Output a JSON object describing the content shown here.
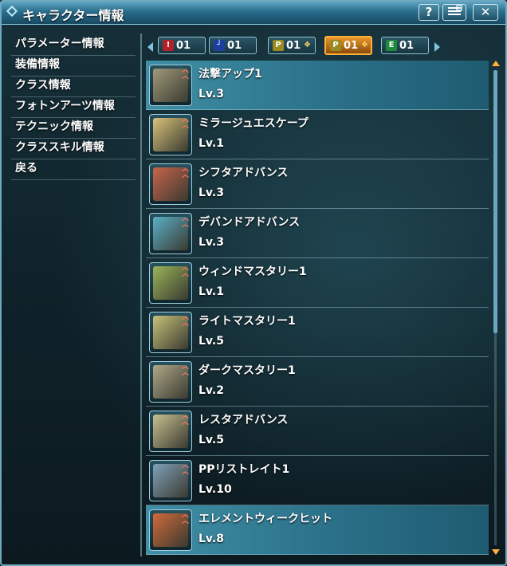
{
  "window": {
    "title": "キャラクター情報",
    "help_label": "?",
    "close_label": "✕"
  },
  "menu": [
    {
      "label": "パラメーター情報",
      "active": false
    },
    {
      "label": "装備情報",
      "active": false
    },
    {
      "label": "クラス情報",
      "active": false
    },
    {
      "label": "フォトンアーツ情報",
      "active": false
    },
    {
      "label": "テクニック情報",
      "active": false
    },
    {
      "label": "クラススキル情報",
      "active": true
    },
    {
      "label": "戻る",
      "active": false
    }
  ],
  "tabs": [
    {
      "number": "01",
      "icon": "sword-icon",
      "icon_color": "#b0232a",
      "glyph": "!",
      "chevron": false,
      "active": false
    },
    {
      "number": "01",
      "icon": "gun-icon",
      "icon_color": "#1f3fa0",
      "glyph": "┘",
      "chevron": false,
      "active": false
    },
    {
      "number": "01",
      "icon": "p-tech-icon",
      "icon_color": "#9a8a20",
      "glyph": "P",
      "chevron": true,
      "active": false
    },
    {
      "number": "01",
      "icon": "p-tech-icon",
      "icon_color": "#9a8a20",
      "glyph": "P",
      "chevron": true,
      "active": true
    },
    {
      "number": "01",
      "icon": "e-tech-icon",
      "icon_color": "#1f8a3a",
      "glyph": "E",
      "chevron": false,
      "active": false
    }
  ],
  "skills": [
    {
      "name": "法撃アップ1",
      "level": "Lv.3",
      "icon": "staff-icon",
      "color": "#a09a7a",
      "highlight": true
    },
    {
      "name": "ミラージュエスケープ",
      "level": "Lv.1",
      "icon": "mirage-escape-icon",
      "color": "#d8c27a",
      "highlight": false
    },
    {
      "name": "シフタアドバンス",
      "level": "Lv.3",
      "icon": "shifta-advance-icon",
      "color": "#c9644a",
      "highlight": false
    },
    {
      "name": "デバンドアドバンス",
      "level": "Lv.3",
      "icon": "deband-advance-icon",
      "color": "#5ab0c8",
      "highlight": false
    },
    {
      "name": "ウィンドマスタリー1",
      "level": "Lv.1",
      "icon": "wind-mastery-icon",
      "color": "#9ab45a",
      "highlight": false
    },
    {
      "name": "ライトマスタリー1",
      "level": "Lv.5",
      "icon": "light-mastery-icon",
      "color": "#c8c27a",
      "highlight": false
    },
    {
      "name": "ダークマスタリー1",
      "level": "Lv.2",
      "icon": "dark-mastery-icon",
      "color": "#b0a88a",
      "highlight": false
    },
    {
      "name": "レスタアドバンス",
      "level": "Lv.5",
      "icon": "resta-advance-icon",
      "color": "#c8c090",
      "highlight": false
    },
    {
      "name": "PPリストレイト1",
      "level": "Lv.10",
      "icon": "pp-restorate-icon",
      "color": "#7fa0b8",
      "highlight": false
    },
    {
      "name": "エレメントウィークヒット",
      "level": "Lv.8",
      "icon": "element-weak-hit-icon",
      "color": "#d06a3a",
      "highlight": true
    }
  ]
}
